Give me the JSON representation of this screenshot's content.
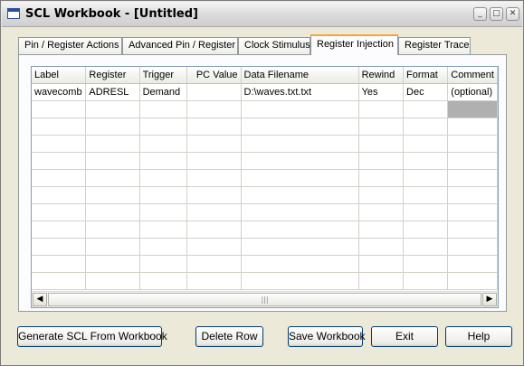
{
  "window": {
    "title": "SCL Workbook - [Untitled]"
  },
  "caption_buttons": {
    "minimize": "_",
    "maximize": "□",
    "close": "✕"
  },
  "tabs": [
    {
      "label": "Pin / Register Actions"
    },
    {
      "label": "Advanced Pin / Register"
    },
    {
      "label": "Clock Stimulus"
    },
    {
      "label": "Register Injection",
      "active": true
    },
    {
      "label": "Register Trace"
    }
  ],
  "grid": {
    "columns": [
      "Label",
      "Register",
      "Trigger",
      "PC Value",
      "Data Filename",
      "Rewind",
      "Format",
      "Comment"
    ],
    "rows": [
      [
        "wavecomb",
        "ADRESL",
        "Demand",
        "",
        "D:\\waves.txt.txt",
        "Yes",
        "Dec",
        "(optional)"
      ]
    ],
    "scrollbar": {
      "left_arrow": "◀",
      "right_arrow": "▶",
      "grip": "|||"
    }
  },
  "buttons": {
    "generate": "Generate SCL From Workbook",
    "delete_row": "Delete Row",
    "save": "Save Workbook",
    "exit": "Exit",
    "help": "Help"
  }
}
